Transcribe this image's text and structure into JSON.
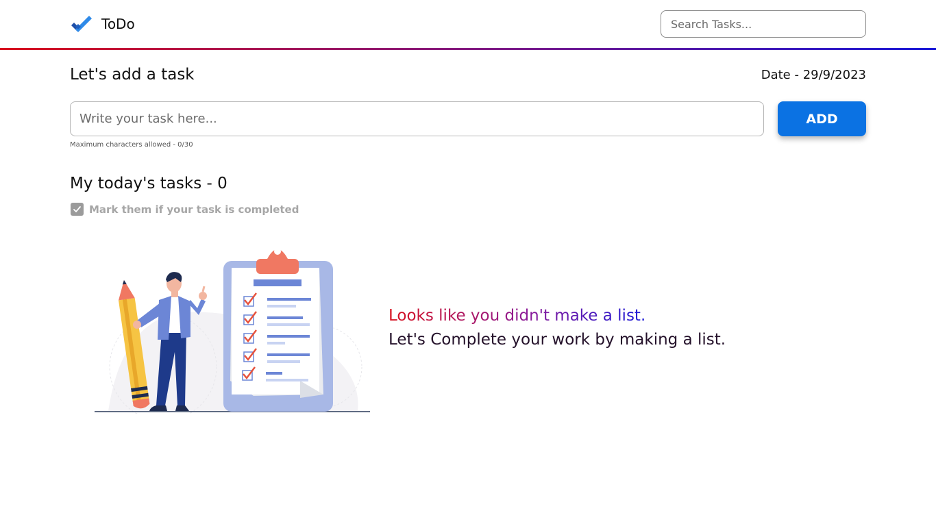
{
  "header": {
    "brand": "ToDo",
    "logo_icon": "double-check-icon",
    "search_placeholder": "Search Tasks..."
  },
  "add_section": {
    "heading": "Let's add a task",
    "date_text": "Date - 29/9/2023",
    "input_placeholder": "Write your task here...",
    "add_button": "ADD",
    "char_hint": "Maximum characters allowed - 0/30"
  },
  "tasks_section": {
    "heading": "My today's tasks - 0",
    "mark_hint": "Mark them if your task is completed"
  },
  "empty_state": {
    "line1": "Looks like you didn't make a list.",
    "line2": "Let's Complete your work by making a list.",
    "illustration": "person-with-pencil-and-checklist-clipboard"
  },
  "colors": {
    "accent_blue": "#0b72e3",
    "gradient_start": "#d8121e",
    "gradient_end": "#1a1ad8"
  }
}
